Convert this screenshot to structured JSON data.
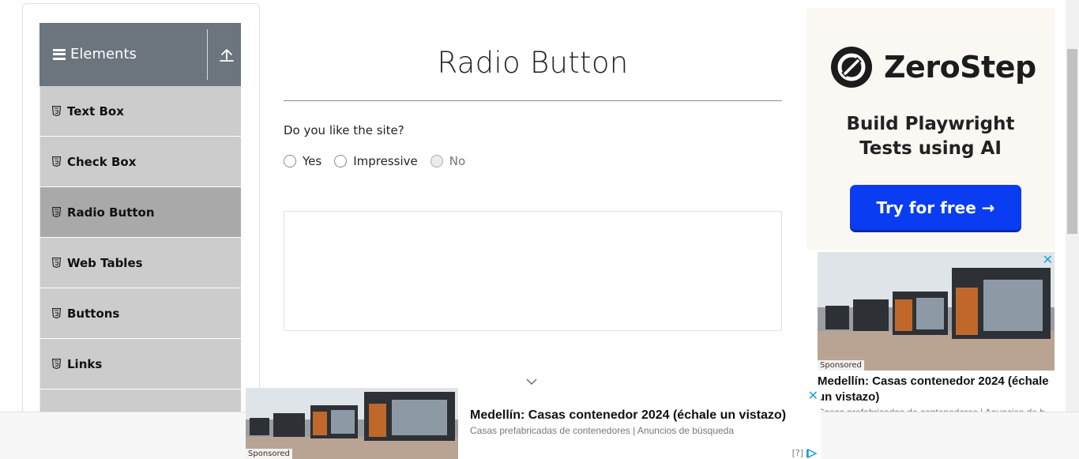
{
  "sidebar": {
    "group_title": "Elements",
    "items": [
      {
        "label": "Text Box",
        "active": false
      },
      {
        "label": "Check Box",
        "active": false
      },
      {
        "label": "Radio Button",
        "active": true
      },
      {
        "label": "Web Tables",
        "active": false
      },
      {
        "label": "Buttons",
        "active": false
      },
      {
        "label": "Links",
        "active": false
      }
    ]
  },
  "main": {
    "title": "Radio Button",
    "question": "Do you like the site?",
    "options": [
      {
        "label": "Yes",
        "disabled": false
      },
      {
        "label": "Impressive",
        "disabled": false
      },
      {
        "label": "No",
        "disabled": true
      }
    ]
  },
  "ad_zerostep": {
    "brand": "ZeroStep",
    "headline": "Build Playwright\nTests using AI",
    "cta": "Try for free →",
    "cta_color": "#0a3df2"
  },
  "ad_side": {
    "sponsored": "Sponsored",
    "headline": "Medellín: Casas contenedor 2024 (échale un vistazo)",
    "subtitle": "Casas prefabricadas de contenedores | Anuncios de b...",
    "close": "✕"
  },
  "ad_bottom": {
    "sponsored": "Sponsored",
    "headline": "Medellín: Casas contenedor 2024 (échale un vistazo)",
    "subtitle": "Casas prefabricadas de contenedores | Anuncios de búsqueda",
    "info": "[?]",
    "close": "✕"
  },
  "colors": {
    "header_bg": "#6c757d",
    "menu_bg": "#cccccc",
    "menu_active_bg": "#a9a9a9",
    "ad_link": "#1aa0d8"
  }
}
